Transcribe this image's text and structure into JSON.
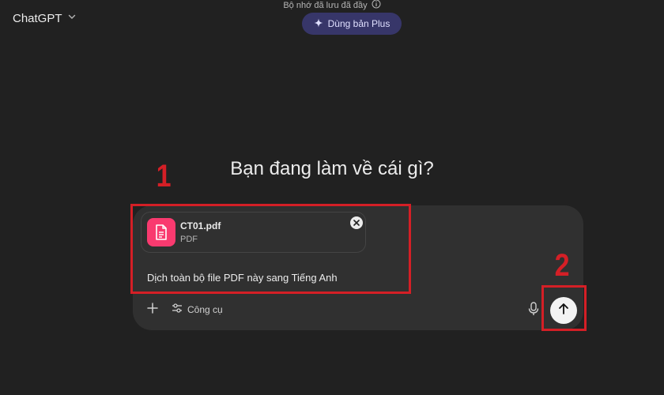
{
  "header": {
    "model_name": "ChatGPT",
    "memory_notice": "Bộ nhớ đã lưu đã đầy",
    "upgrade_label": "Dùng bản Plus"
  },
  "main": {
    "headline": "Bạn đang làm về cái gì?"
  },
  "composer": {
    "attachment": {
      "file_name": "CT01.pdf",
      "file_type": "PDF"
    },
    "prompt_text": "Dịch toàn bộ file PDF này sang Tiếng Anh",
    "tools_label": "Công cụ"
  },
  "annotations": {
    "step1": "1",
    "step2": "2",
    "highlight_color": "#d41f26"
  },
  "icons": {
    "model_menu": "chevron-down-icon",
    "memory_info": "info-icon",
    "upgrade": "sparkle-icon",
    "file": "document-icon",
    "remove": "close-icon",
    "add": "plus-icon",
    "tools": "sliders-icon",
    "mic": "microphone-icon",
    "send": "arrow-up-icon"
  },
  "colors": {
    "background": "#212121",
    "composer": "#303030",
    "file_tile": "#f93a6f",
    "upgrade_button": "#373669"
  }
}
